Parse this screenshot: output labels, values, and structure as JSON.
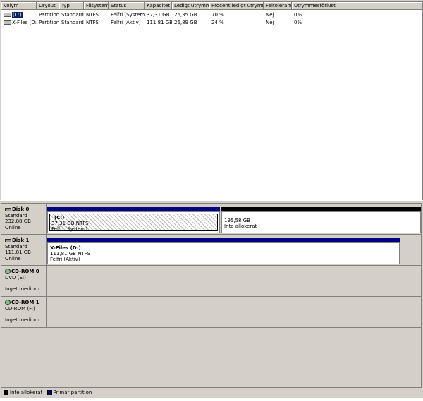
{
  "volume_list": {
    "columns": [
      "Volym",
      "Layout",
      "Typ",
      "Filsystem",
      "Status",
      "Kapacitet",
      "Ledigt utrymme",
      "Procent ledigt utrymme",
      "Feltolerans",
      "Utrymmesförlust"
    ],
    "rows": [
      {
        "volume": "(C:)",
        "layout": "Partition",
        "type": "Standard",
        "fs": "NTFS",
        "status": "Felfri (System)",
        "capacity": "37,31 GB",
        "free": "26,35 GB",
        "pct_free": "70 %",
        "fault": "Nej",
        "overhead": "0%"
      },
      {
        "volume": "X-Files (D:)",
        "layout": "Partition",
        "type": "Standard",
        "fs": "NTFS",
        "status": "Felfri (Aktiv)",
        "capacity": "111,81 GB",
        "free": "26,89 GB",
        "pct_free": "24 %",
        "fault": "Nej",
        "overhead": "0%"
      }
    ]
  },
  "disks": [
    {
      "name": "Disk 0",
      "type": "Standard",
      "size": "232,88 GB",
      "state": "Online",
      "partitions": [
        {
          "name": "(C:)",
          "size_fs": "37,31 GB NTFS",
          "status": "Felfri (System)"
        },
        {
          "name": "",
          "size_fs": "195,58 GB",
          "status": "Inte allokerat"
        }
      ]
    },
    {
      "name": "Disk 1",
      "type": "Standard",
      "size": "111,81 GB",
      "state": "Online",
      "partitions": [
        {
          "name": "X-Files  (D:)",
          "size_fs": "111,81 GB NTFS",
          "status": "Felfri (Aktiv)"
        }
      ]
    },
    {
      "name": "CD-ROM 0",
      "type": "DVD (E:)",
      "state": "Inget medium"
    },
    {
      "name": "CD-ROM 1",
      "type": "CD-ROM (F:)",
      "state": "Inget medium"
    }
  ],
  "legend": {
    "unallocated": "Inte allokerat",
    "primary": "Primär partition",
    "colors": {
      "unallocated": "#000000",
      "primary": "#000080"
    }
  }
}
